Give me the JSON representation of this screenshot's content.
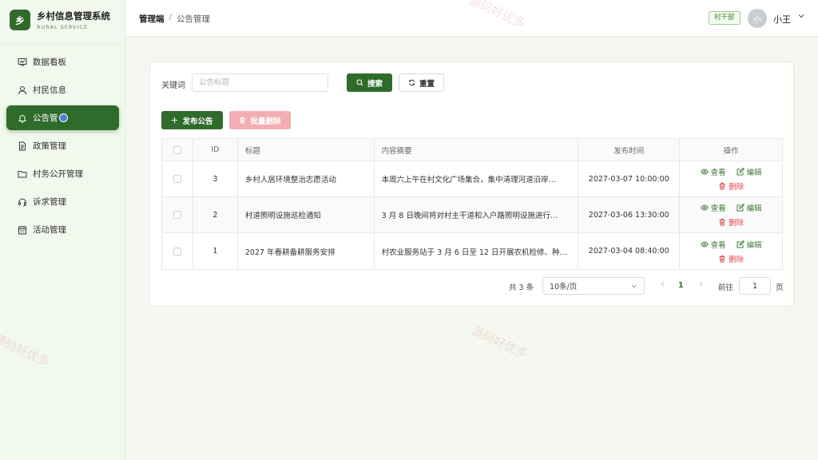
{
  "brand": {
    "logo": "乡",
    "title": "乡村信息管理系统",
    "subtitle": "RURAL SERVICE"
  },
  "sidebar": {
    "items": [
      {
        "label": "数据看板",
        "icon": "dashboard-icon"
      },
      {
        "label": "村民信息",
        "icon": "user-icon"
      },
      {
        "label": "公告管",
        "icon": "bell-icon",
        "active": true
      },
      {
        "label": "政策管理",
        "icon": "document-icon"
      },
      {
        "label": "村务公开管理",
        "icon": "folder-icon"
      },
      {
        "label": "诉求管理",
        "icon": "headset-icon"
      },
      {
        "label": "活动管理",
        "icon": "calendar-icon"
      }
    ]
  },
  "header": {
    "breadcrumb_root": "管理端",
    "breadcrumb_sep": "/",
    "breadcrumb_current": "公告管理",
    "role": "村干部",
    "avatar": "小",
    "username": "小王"
  },
  "search": {
    "label": "关键词",
    "placeholder": "公告标题",
    "value": "",
    "search_label": "搜索",
    "reset_label": "重置"
  },
  "actions": {
    "publish_label": "发布公告",
    "batch_delete_label": "批量删除"
  },
  "table": {
    "headers": {
      "id": "ID",
      "title": "标题",
      "summary": "内容摘要",
      "time": "发布时间",
      "ops": "操作"
    },
    "ops": {
      "view": "查看",
      "edit": "编辑",
      "delete": "删除"
    },
    "rows": [
      {
        "id": "3",
        "title": "乡村人居环境整治志愿活动",
        "summary": "本周六上午在村文化广场集合，集中清理河道沿岸…",
        "time": "2027-03-07 10:00:00"
      },
      {
        "id": "2",
        "title": "村道照明设施巡检通知",
        "summary": "3 月 8 日晚间将对村主干道和入户路照明设施进行…",
        "time": "2027-03-06 13:30:00"
      },
      {
        "id": "1",
        "title": "2027 年春耕备耕服务安排",
        "summary": "村农业服务站于 3 月 6 日至 12 日开展农机检修、种…",
        "time": "2027-03-04 08:40:00"
      }
    ]
  },
  "pagination": {
    "total": "共 3 条",
    "page_size": "10条/页",
    "current_page": "1",
    "goto_label": "前往",
    "goto_value": "1",
    "unit": "页"
  },
  "watermark": "源码好优多",
  "colors": {
    "primary": "#2f6b2a",
    "danger": "#e0474f",
    "danger_light": "#f2aeb2",
    "page_bg": "#f4f8f0"
  }
}
